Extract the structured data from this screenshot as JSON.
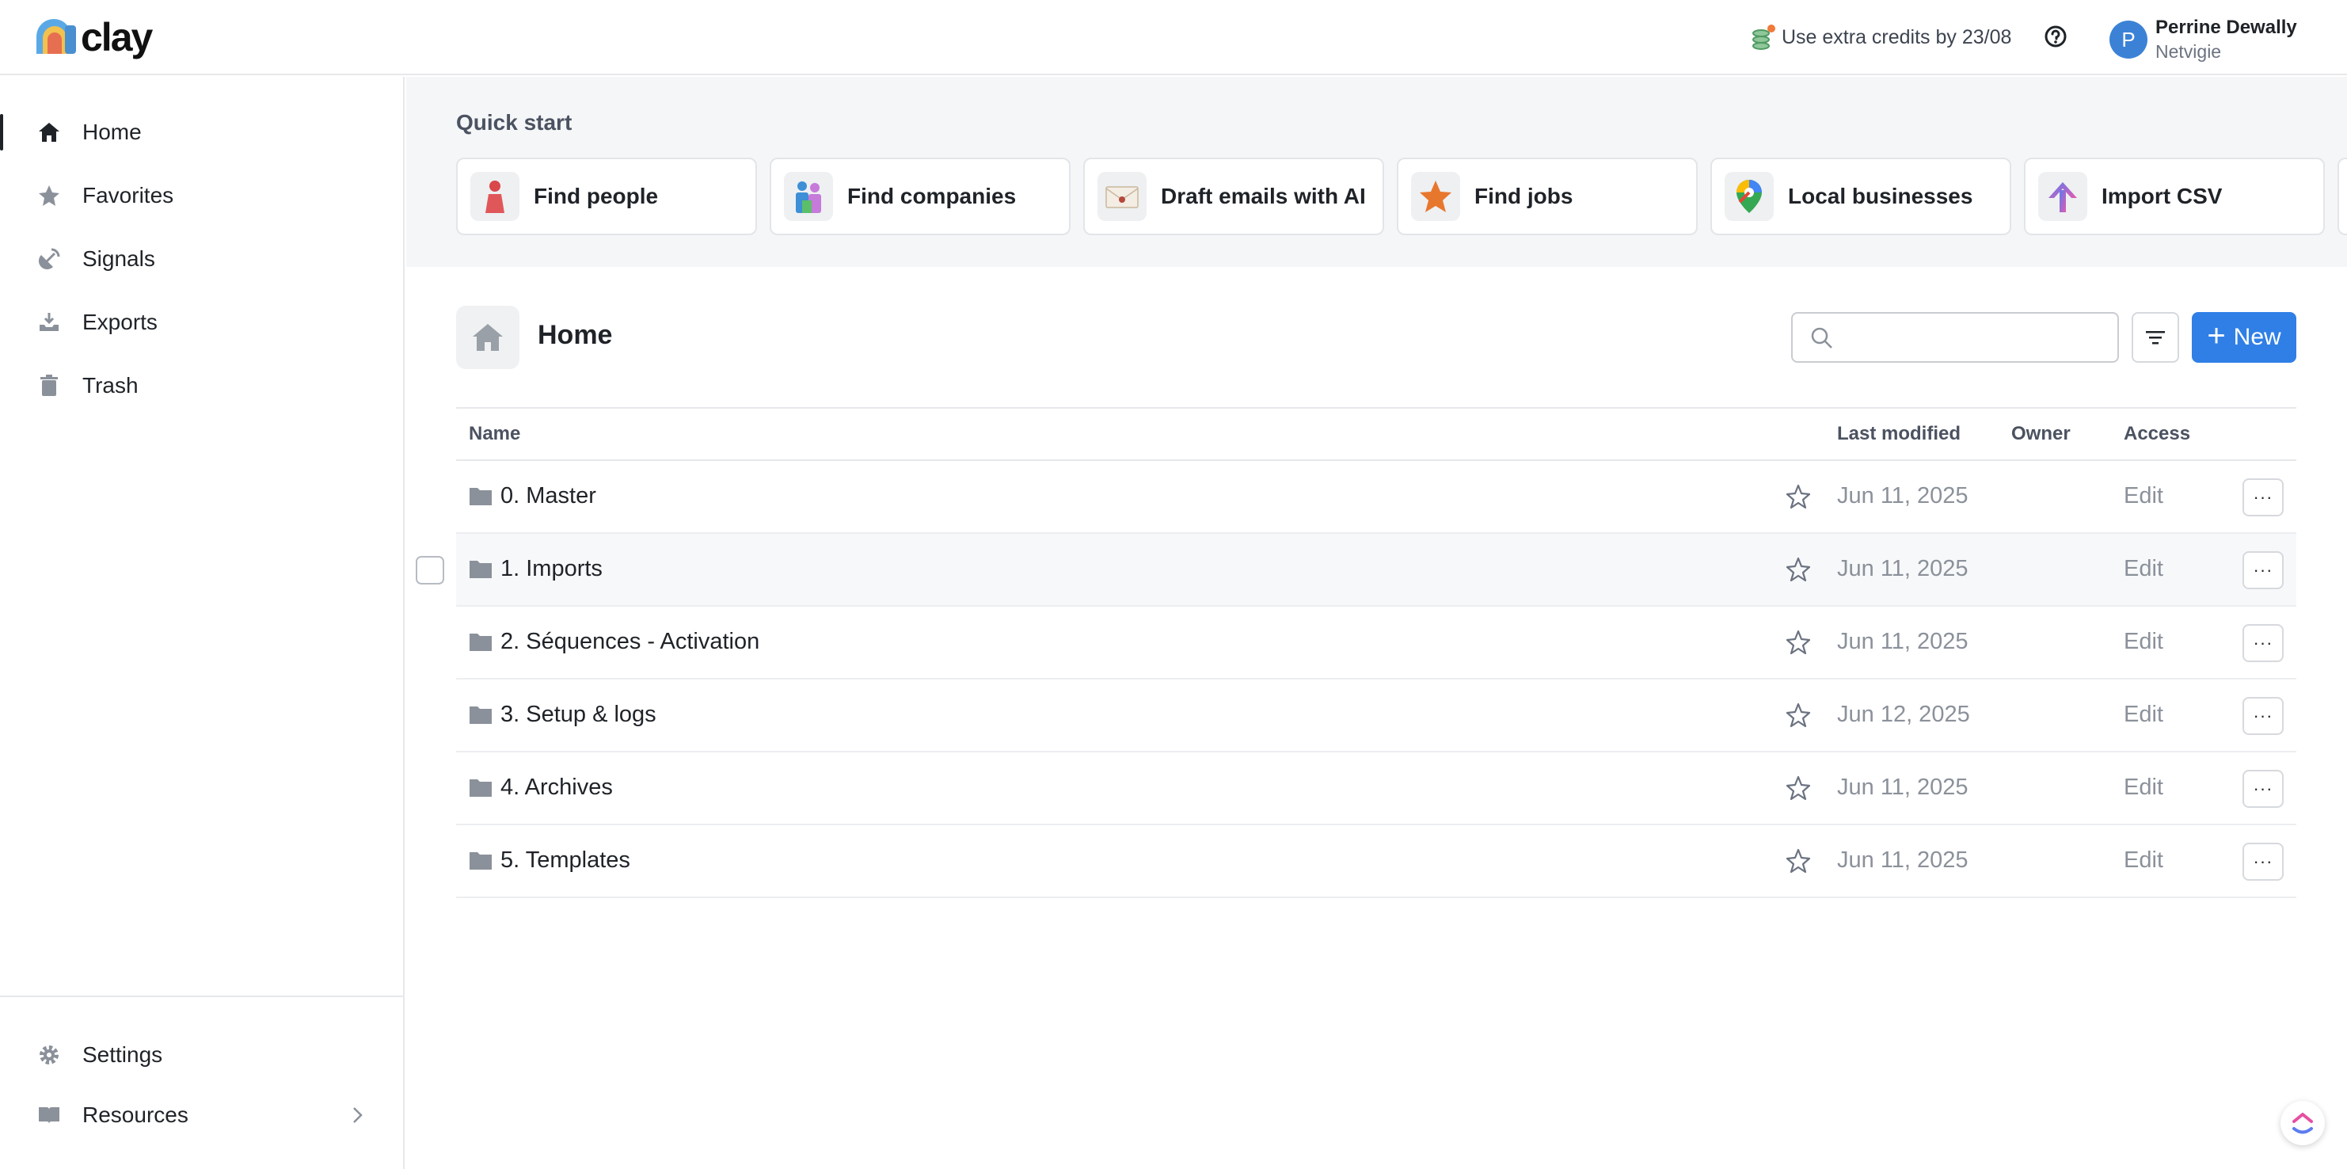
{
  "app": {
    "name": "clay"
  },
  "header": {
    "credits_text": "Use extra credits by 23/08",
    "user": {
      "initial": "P",
      "name": "Perrine Dewally",
      "org": "Netvigie"
    }
  },
  "sidebar": {
    "items": [
      {
        "label": "Home",
        "icon": "home-icon"
      },
      {
        "label": "Favorites",
        "icon": "star-icon"
      },
      {
        "label": "Signals",
        "icon": "satellite-icon"
      },
      {
        "label": "Exports",
        "icon": "download-tray-icon"
      },
      {
        "label": "Trash",
        "icon": "trash-icon"
      }
    ],
    "bottom": [
      {
        "label": "Settings",
        "icon": "gear-icon"
      },
      {
        "label": "Resources",
        "icon": "book-icon"
      }
    ]
  },
  "quick_start": {
    "title": "Quick start",
    "cards": [
      {
        "label": "Find people",
        "icon": "person-icon"
      },
      {
        "label": "Find companies",
        "icon": "people-group-icon"
      },
      {
        "label": "Draft emails with AI",
        "icon": "envelope-icon"
      },
      {
        "label": "Find jobs",
        "icon": "star-badge-icon"
      },
      {
        "label": "Local businesses",
        "icon": "map-pin-icon"
      },
      {
        "label": "Import CSV",
        "icon": "upload-arrow-icon"
      }
    ]
  },
  "main": {
    "title": "Home",
    "search_placeholder": "",
    "new_label": "New",
    "columns": {
      "name": "Name",
      "last_modified": "Last modified",
      "owner": "Owner",
      "access": "Access"
    },
    "rows": [
      {
        "name": "0. Master",
        "date": "Jun 11, 2025",
        "access": "Edit"
      },
      {
        "name": "1. Imports",
        "date": "Jun 11, 2025",
        "access": "Edit"
      },
      {
        "name": "2. Séquences - Activation",
        "date": "Jun 11, 2025",
        "access": "Edit"
      },
      {
        "name": "3. Setup & logs",
        "date": "Jun 12, 2025",
        "access": "Edit"
      },
      {
        "name": "4. Archives",
        "date": "Jun 11, 2025",
        "access": "Edit"
      },
      {
        "name": "5. Templates",
        "date": "Jun 11, 2025",
        "access": "Edit"
      }
    ],
    "more_label": "···"
  },
  "colors": {
    "accent": "#2f7fe6",
    "text": "#1f2328",
    "muted": "#8b919a",
    "panel": "#f5f6f8"
  }
}
